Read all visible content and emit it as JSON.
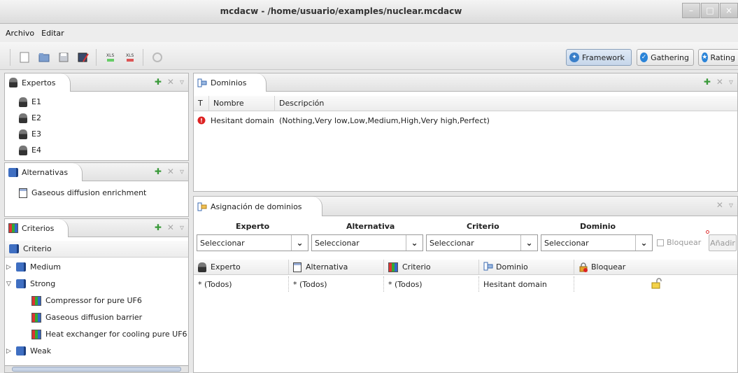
{
  "window": {
    "title": "mcdacw - /home/usuario/examples/nuclear.mcdacw"
  },
  "menu": [
    "Archivo",
    "Editar"
  ],
  "toolbar": {
    "icons": [
      "new-file-icon",
      "open-folder-icon",
      "save-icon",
      "save-as-icon",
      "import-xls-icon",
      "export-xls-icon",
      "refresh-icon"
    ],
    "perspectives": [
      {
        "label": "Framework",
        "active": true
      },
      {
        "label": "Gathering",
        "active": false
      },
      {
        "label": "Rating",
        "active": false
      }
    ]
  },
  "expertos": {
    "tab": "Expertos",
    "items": [
      "E1",
      "E2",
      "E3",
      "E4"
    ]
  },
  "alternativas": {
    "tab": "Alternativas",
    "items": [
      "Gaseous diffusion enrichment"
    ]
  },
  "criterios": {
    "tab": "Criterios",
    "header": "Criterio",
    "items": [
      {
        "label": "Medium",
        "level": 0,
        "expanded": false
      },
      {
        "label": "Strong",
        "level": 0,
        "expanded": true
      },
      {
        "label": "Compressor for pure UF6",
        "level": 1
      },
      {
        "label": "Gaseous diffusion barrier",
        "level": 1
      },
      {
        "label": "Heat exchanger for cooling pure UF6",
        "level": 1
      },
      {
        "label": "Weak",
        "level": 0,
        "expanded": false
      }
    ]
  },
  "dominios": {
    "tab": "Dominios",
    "columns": [
      "T",
      "Nombre",
      "Descripción"
    ],
    "rows": [
      {
        "name": "Hesitant domain",
        "description": "(Nothing,Very low,Low,Medium,High,Very high,Perfect)"
      }
    ]
  },
  "asignacion": {
    "tab": "Asignación de dominios",
    "filters": [
      {
        "label": "Experto",
        "value": "Seleccionar"
      },
      {
        "label": "Alternativa",
        "value": "Seleccionar"
      },
      {
        "label": "Criterio",
        "value": "Seleccionar"
      },
      {
        "label": "Dominio",
        "value": "Seleccionar"
      }
    ],
    "bloquear_label": "Bloquear",
    "add_label": "Añadir",
    "columns": [
      "Experto",
      "Alternativa",
      "Criterio",
      "Dominio",
      "Bloquear"
    ],
    "rows": [
      {
        "experto": "* (Todos)",
        "alternativa": "* (Todos)",
        "criterio": "* (Todos)",
        "dominio": "Hesitant domain"
      }
    ]
  }
}
